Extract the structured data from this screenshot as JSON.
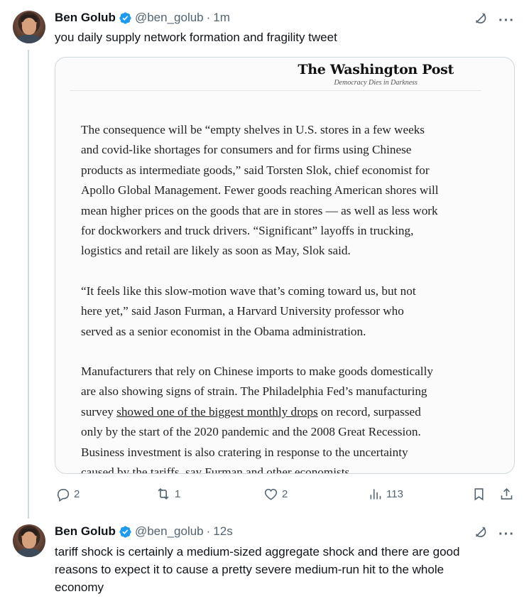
{
  "tweets": [
    {
      "name": "Ben Golub",
      "handle": "@ben_golub",
      "separator": "·",
      "time": "1m",
      "text": "you daily supply network formation and fragility tweet",
      "actions": {
        "replies": "2",
        "retweets": "1",
        "likes": "2",
        "views": "113"
      }
    },
    {
      "name": "Ben Golub",
      "handle": "@ben_golub",
      "separator": "·",
      "time": "12s",
      "text_lines": [
        "tariff shock is certainly a medium-sized aggregate shock and there are good",
        "reasons to expect it to cause a pretty severe medium-run hit to the whole",
        "economy"
      ]
    }
  ],
  "media": {
    "masthead_title": "The Washington Post",
    "masthead_slogan": "Democracy Dies in Darkness",
    "paragraphs": [
      [
        "The consequence will be “empty shelves in U.S. stores in a few weeks",
        "and covid-like shortages for consumers and for firms using Chinese",
        "products as intermediate goods,” said Torsten Slok, chief economist for",
        "Apollo Global Management. Fewer goods reaching American shores will",
        "mean higher prices on the goods that are in stores — as well as less work",
        "for dockworkers and truck drivers. “Significant” layoffs in trucking,",
        "logistics and retail are likely as soon as May, Slok said."
      ],
      [
        "“It feels like this slow-motion wave that’s coming toward us, but not",
        "here yet,” said Jason Furman, a Harvard University professor who",
        "served as a senior economist in the Obama administration."
      ]
    ],
    "paragraph3": {
      "line1": "Manufacturers that rely on Chinese imports to make goods domestically",
      "line2": "are also showing signs of strain. The Philadelphia Fed’s manufacturing",
      "line3_pre": "survey ",
      "line3_link": "showed one of the biggest monthly drops",
      "line3_post": " on record, surpassed",
      "line4": "only by the start of the 2020 pandemic and the 2008 Great Recession.",
      "line5": "Business investment is also cratering in response to the uncertainty",
      "line6": "caused by the tariffs, say Furman and other economists."
    }
  },
  "icons": {
    "verified": "verified-badge-icon",
    "grok": "grok-icon",
    "more": "more-icon",
    "reply": "reply-icon",
    "retweet": "retweet-icon",
    "like": "like-icon",
    "views": "views-icon",
    "bookmark": "bookmark-icon",
    "share": "share-icon"
  },
  "colors": {
    "verified": "#1d9bf0",
    "secondary_text": "#536471",
    "border": "#cfd9de"
  },
  "more_glyph": "···"
}
